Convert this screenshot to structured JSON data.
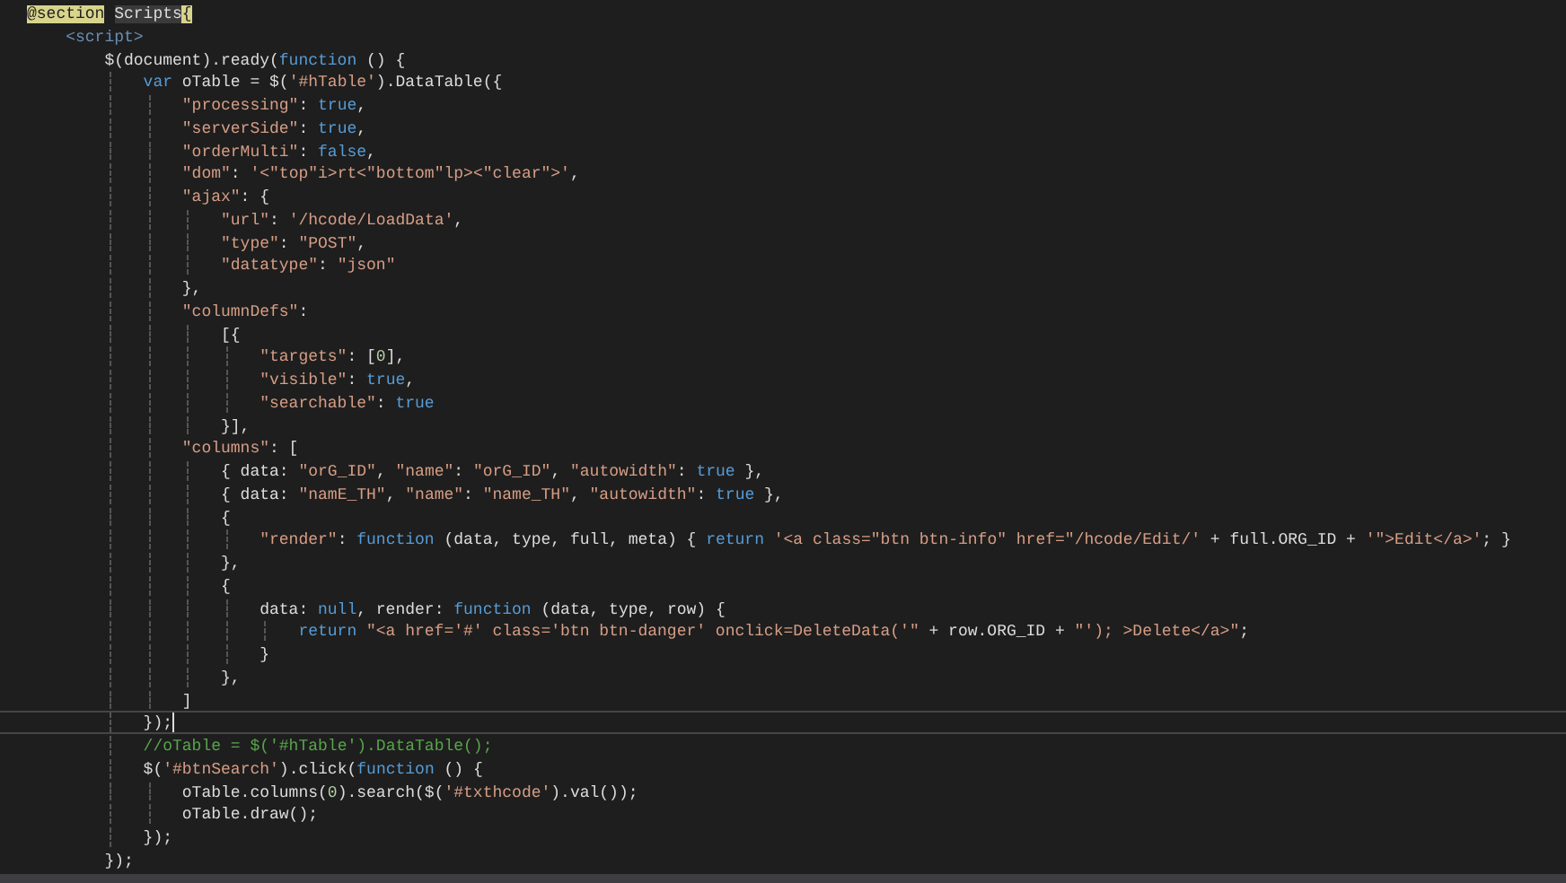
{
  "editor": {
    "lines": [
      {
        "current": false,
        "tokens": [
          {
            "kind": "razor",
            "text": "@section"
          },
          {
            "kind": "razor_name",
            "text": "Scripts"
          },
          {
            "kind": "brace_match",
            "text": "{"
          }
        ],
        "children": [
          {
            "current": false,
            "tokens": [
              {
                "kind": "tag",
                "text": "<script>"
              }
            ],
            "children": [
              {
                "current": false,
                "tokens": [
                  {
                    "kind": "plain",
                    "text": "$(document).ready("
                  },
                  {
                    "kind": "keyword",
                    "text": "function"
                  },
                  {
                    "kind": "plain",
                    "text": " () {"
                  }
                ],
                "children": [
                  {
                    "current": false,
                    "tokens": [
                      {
                        "kind": "keyword",
                        "text": "var"
                      },
                      {
                        "kind": "plain",
                        "text": " oTable = $("
                      },
                      {
                        "kind": "string",
                        "text": "'#hTable'"
                      },
                      {
                        "kind": "plain",
                        "text": ").DataTable({"
                      }
                    ],
                    "children": [
                      {
                        "current": false,
                        "tokens": [
                          {
                            "kind": "string",
                            "text": "\"processing\""
                          },
                          {
                            "kind": "plain",
                            "text": ": "
                          },
                          {
                            "kind": "keyword",
                            "text": "true"
                          },
                          {
                            "kind": "plain",
                            "text": ","
                          }
                        ]
                      },
                      {
                        "current": false,
                        "tokens": [
                          {
                            "kind": "string",
                            "text": "\"serverSide\""
                          },
                          {
                            "kind": "plain",
                            "text": ": "
                          },
                          {
                            "kind": "keyword",
                            "text": "true"
                          },
                          {
                            "kind": "plain",
                            "text": ","
                          }
                        ]
                      },
                      {
                        "current": false,
                        "tokens": [
                          {
                            "kind": "string",
                            "text": "\"orderMulti\""
                          },
                          {
                            "kind": "plain",
                            "text": ": "
                          },
                          {
                            "kind": "keyword",
                            "text": "false"
                          },
                          {
                            "kind": "plain",
                            "text": ","
                          }
                        ]
                      },
                      {
                        "current": false,
                        "tokens": [
                          {
                            "kind": "string",
                            "text": "\"dom\""
                          },
                          {
                            "kind": "plain",
                            "text": ": "
                          },
                          {
                            "kind": "string",
                            "text": "'<\"top\"i>rt<\"bottom\"lp><\"clear\">'"
                          },
                          {
                            "kind": "plain",
                            "text": ","
                          }
                        ]
                      },
                      {
                        "current": false,
                        "tokens": [
                          {
                            "kind": "string",
                            "text": "\"ajax\""
                          },
                          {
                            "kind": "plain",
                            "text": ": {"
                          }
                        ],
                        "children": [
                          {
                            "current": false,
                            "tokens": [
                              {
                                "kind": "string",
                                "text": "\"url\""
                              },
                              {
                                "kind": "plain",
                                "text": ": "
                              },
                              {
                                "kind": "string",
                                "text": "'/hcode/LoadData'"
                              },
                              {
                                "kind": "plain",
                                "text": ","
                              }
                            ]
                          },
                          {
                            "current": false,
                            "tokens": [
                              {
                                "kind": "string",
                                "text": "\"type\""
                              },
                              {
                                "kind": "plain",
                                "text": ": "
                              },
                              {
                                "kind": "string",
                                "text": "\"POST\""
                              },
                              {
                                "kind": "plain",
                                "text": ","
                              }
                            ]
                          },
                          {
                            "current": false,
                            "tokens": [
                              {
                                "kind": "string",
                                "text": "\"datatype\""
                              },
                              {
                                "kind": "plain",
                                "text": ": "
                              },
                              {
                                "kind": "string",
                                "text": "\"json\""
                              }
                            ]
                          }
                        ]
                      },
                      {
                        "current": false,
                        "tokens": [
                          {
                            "kind": "plain",
                            "text": "},"
                          }
                        ]
                      },
                      {
                        "current": false,
                        "tokens": [
                          {
                            "kind": "string",
                            "text": "\"columnDefs\""
                          },
                          {
                            "kind": "plain",
                            "text": ":"
                          }
                        ],
                        "children": [
                          {
                            "current": false,
                            "tokens": [
                              {
                                "kind": "plain",
                                "text": "[{"
                              }
                            ],
                            "children": [
                              {
                                "current": false,
                                "tokens": [
                                  {
                                    "kind": "string",
                                    "text": "\"targets\""
                                  },
                                  {
                                    "kind": "plain",
                                    "text": ": ["
                                  },
                                  {
                                    "kind": "number",
                                    "text": "0"
                                  },
                                  {
                                    "kind": "plain",
                                    "text": "],"
                                  }
                                ]
                              },
                              {
                                "current": false,
                                "tokens": [
                                  {
                                    "kind": "string",
                                    "text": "\"visible\""
                                  },
                                  {
                                    "kind": "plain",
                                    "text": ": "
                                  },
                                  {
                                    "kind": "keyword",
                                    "text": "true"
                                  },
                                  {
                                    "kind": "plain",
                                    "text": ","
                                  }
                                ]
                              },
                              {
                                "current": false,
                                "tokens": [
                                  {
                                    "kind": "string",
                                    "text": "\"searchable\""
                                  },
                                  {
                                    "kind": "plain",
                                    "text": ": "
                                  },
                                  {
                                    "kind": "keyword",
                                    "text": "true"
                                  }
                                ]
                              }
                            ]
                          },
                          {
                            "current": false,
                            "tokens": [
                              {
                                "kind": "plain",
                                "text": "}],"
                              }
                            ]
                          }
                        ]
                      },
                      {
                        "current": false,
                        "tokens": [
                          {
                            "kind": "string",
                            "text": "\"columns\""
                          },
                          {
                            "kind": "plain",
                            "text": ": ["
                          }
                        ],
                        "children": [
                          {
                            "current": false,
                            "tokens": [
                              {
                                "kind": "plain",
                                "text": "{ data: "
                              },
                              {
                                "kind": "string",
                                "text": "\"orG_ID\""
                              },
                              {
                                "kind": "plain",
                                "text": ", "
                              },
                              {
                                "kind": "string",
                                "text": "\"name\""
                              },
                              {
                                "kind": "plain",
                                "text": ": "
                              },
                              {
                                "kind": "string",
                                "text": "\"orG_ID\""
                              },
                              {
                                "kind": "plain",
                                "text": ", "
                              },
                              {
                                "kind": "string",
                                "text": "\"autowidth\""
                              },
                              {
                                "kind": "plain",
                                "text": ": "
                              },
                              {
                                "kind": "keyword",
                                "text": "true"
                              },
                              {
                                "kind": "plain",
                                "text": " },"
                              }
                            ]
                          },
                          {
                            "current": false,
                            "tokens": [
                              {
                                "kind": "plain",
                                "text": "{ data: "
                              },
                              {
                                "kind": "string",
                                "text": "\"namE_TH\""
                              },
                              {
                                "kind": "plain",
                                "text": ", "
                              },
                              {
                                "kind": "string",
                                "text": "\"name\""
                              },
                              {
                                "kind": "plain",
                                "text": ": "
                              },
                              {
                                "kind": "string",
                                "text": "\"name_TH\""
                              },
                              {
                                "kind": "plain",
                                "text": ", "
                              },
                              {
                                "kind": "string",
                                "text": "\"autowidth\""
                              },
                              {
                                "kind": "plain",
                                "text": ": "
                              },
                              {
                                "kind": "keyword",
                                "text": "true"
                              },
                              {
                                "kind": "plain",
                                "text": " },"
                              }
                            ]
                          },
                          {
                            "current": false,
                            "tokens": [
                              {
                                "kind": "plain",
                                "text": "{"
                              }
                            ],
                            "children": [
                              {
                                "current": false,
                                "tokens": [
                                  {
                                    "kind": "string",
                                    "text": "\"render\""
                                  },
                                  {
                                    "kind": "plain",
                                    "text": ": "
                                  },
                                  {
                                    "kind": "keyword",
                                    "text": "function"
                                  },
                                  {
                                    "kind": "plain",
                                    "text": " (data, type, full, meta) { "
                                  },
                                  {
                                    "kind": "keyword",
                                    "text": "return"
                                  },
                                  {
                                    "kind": "string",
                                    "text": " '<a class=\"btn btn-info\" href=\"/hcode/Edit/'"
                                  },
                                  {
                                    "kind": "plain",
                                    "text": " + full.ORG_ID + "
                                  },
                                  {
                                    "kind": "string",
                                    "text": "'\">Edit</a>'"
                                  },
                                  {
                                    "kind": "plain",
                                    "text": "; }"
                                  }
                                ]
                              }
                            ]
                          },
                          {
                            "current": false,
                            "tokens": [
                              {
                                "kind": "plain",
                                "text": "},"
                              }
                            ]
                          },
                          {
                            "current": false,
                            "tokens": [
                              {
                                "kind": "plain",
                                "text": "{"
                              }
                            ],
                            "children": [
                              {
                                "current": false,
                                "tokens": [
                                  {
                                    "kind": "plain",
                                    "text": "data: "
                                  },
                                  {
                                    "kind": "keyword",
                                    "text": "null"
                                  },
                                  {
                                    "kind": "plain",
                                    "text": ", render: "
                                  },
                                  {
                                    "kind": "keyword",
                                    "text": "function"
                                  },
                                  {
                                    "kind": "plain",
                                    "text": " (data, type, row) {"
                                  }
                                ],
                                "children": [
                                  {
                                    "current": false,
                                    "tokens": [
                                      {
                                        "kind": "keyword",
                                        "text": "return"
                                      },
                                      {
                                        "kind": "string",
                                        "text": " \"<a href='#' class='btn btn-danger' onclick=DeleteData('\""
                                      },
                                      {
                                        "kind": "plain",
                                        "text": " + row.ORG_ID + "
                                      },
                                      {
                                        "kind": "string",
                                        "text": "\"'); >Delete</a>\""
                                      },
                                      {
                                        "kind": "plain",
                                        "text": ";"
                                      }
                                    ]
                                  }
                                ]
                              },
                              {
                                "current": false,
                                "tokens": [
                                  {
                                    "kind": "plain",
                                    "text": "}"
                                  }
                                ]
                              }
                            ]
                          },
                          {
                            "current": false,
                            "tokens": [
                              {
                                "kind": "plain",
                                "text": "},"
                              }
                            ]
                          }
                        ]
                      },
                      {
                        "current": false,
                        "tokens": [
                          {
                            "kind": "plain",
                            "text": "]"
                          }
                        ]
                      }
                    ]
                  },
                  {
                    "current": true,
                    "tokens": [
                      {
                        "kind": "plain",
                        "text": "});"
                      }
                    ]
                  },
                  {
                    "current": false,
                    "tokens": [
                      {
                        "kind": "comment",
                        "text": "//oTable = $('#hTable').DataTable();"
                      }
                    ]
                  },
                  {
                    "current": false,
                    "tokens": [
                      {
                        "kind": "plain",
                        "text": "$("
                      },
                      {
                        "kind": "string",
                        "text": "'#btnSearch'"
                      },
                      {
                        "kind": "plain",
                        "text": ").click("
                      },
                      {
                        "kind": "keyword",
                        "text": "function"
                      },
                      {
                        "kind": "plain",
                        "text": " () {"
                      }
                    ],
                    "children": [
                      {
                        "current": false,
                        "tokens": [
                          {
                            "kind": "plain",
                            "text": "oTable.columns("
                          },
                          {
                            "kind": "number",
                            "text": "0"
                          },
                          {
                            "kind": "plain",
                            "text": ").search($("
                          },
                          {
                            "kind": "string",
                            "text": "'#txthcode'"
                          },
                          {
                            "kind": "plain",
                            "text": ").val());"
                          }
                        ]
                      },
                      {
                        "current": false,
                        "tokens": [
                          {
                            "kind": "plain",
                            "text": "oTable.draw();"
                          }
                        ]
                      }
                    ]
                  },
                  {
                    "current": false,
                    "tokens": [
                      {
                        "kind": "plain",
                        "text": "});"
                      }
                    ]
                  }
                ]
              },
              {
                "current": false,
                "tokens": [
                  {
                    "kind": "plain",
                    "text": "});"
                  }
                ]
              }
            ]
          }
        ]
      }
    ]
  }
}
